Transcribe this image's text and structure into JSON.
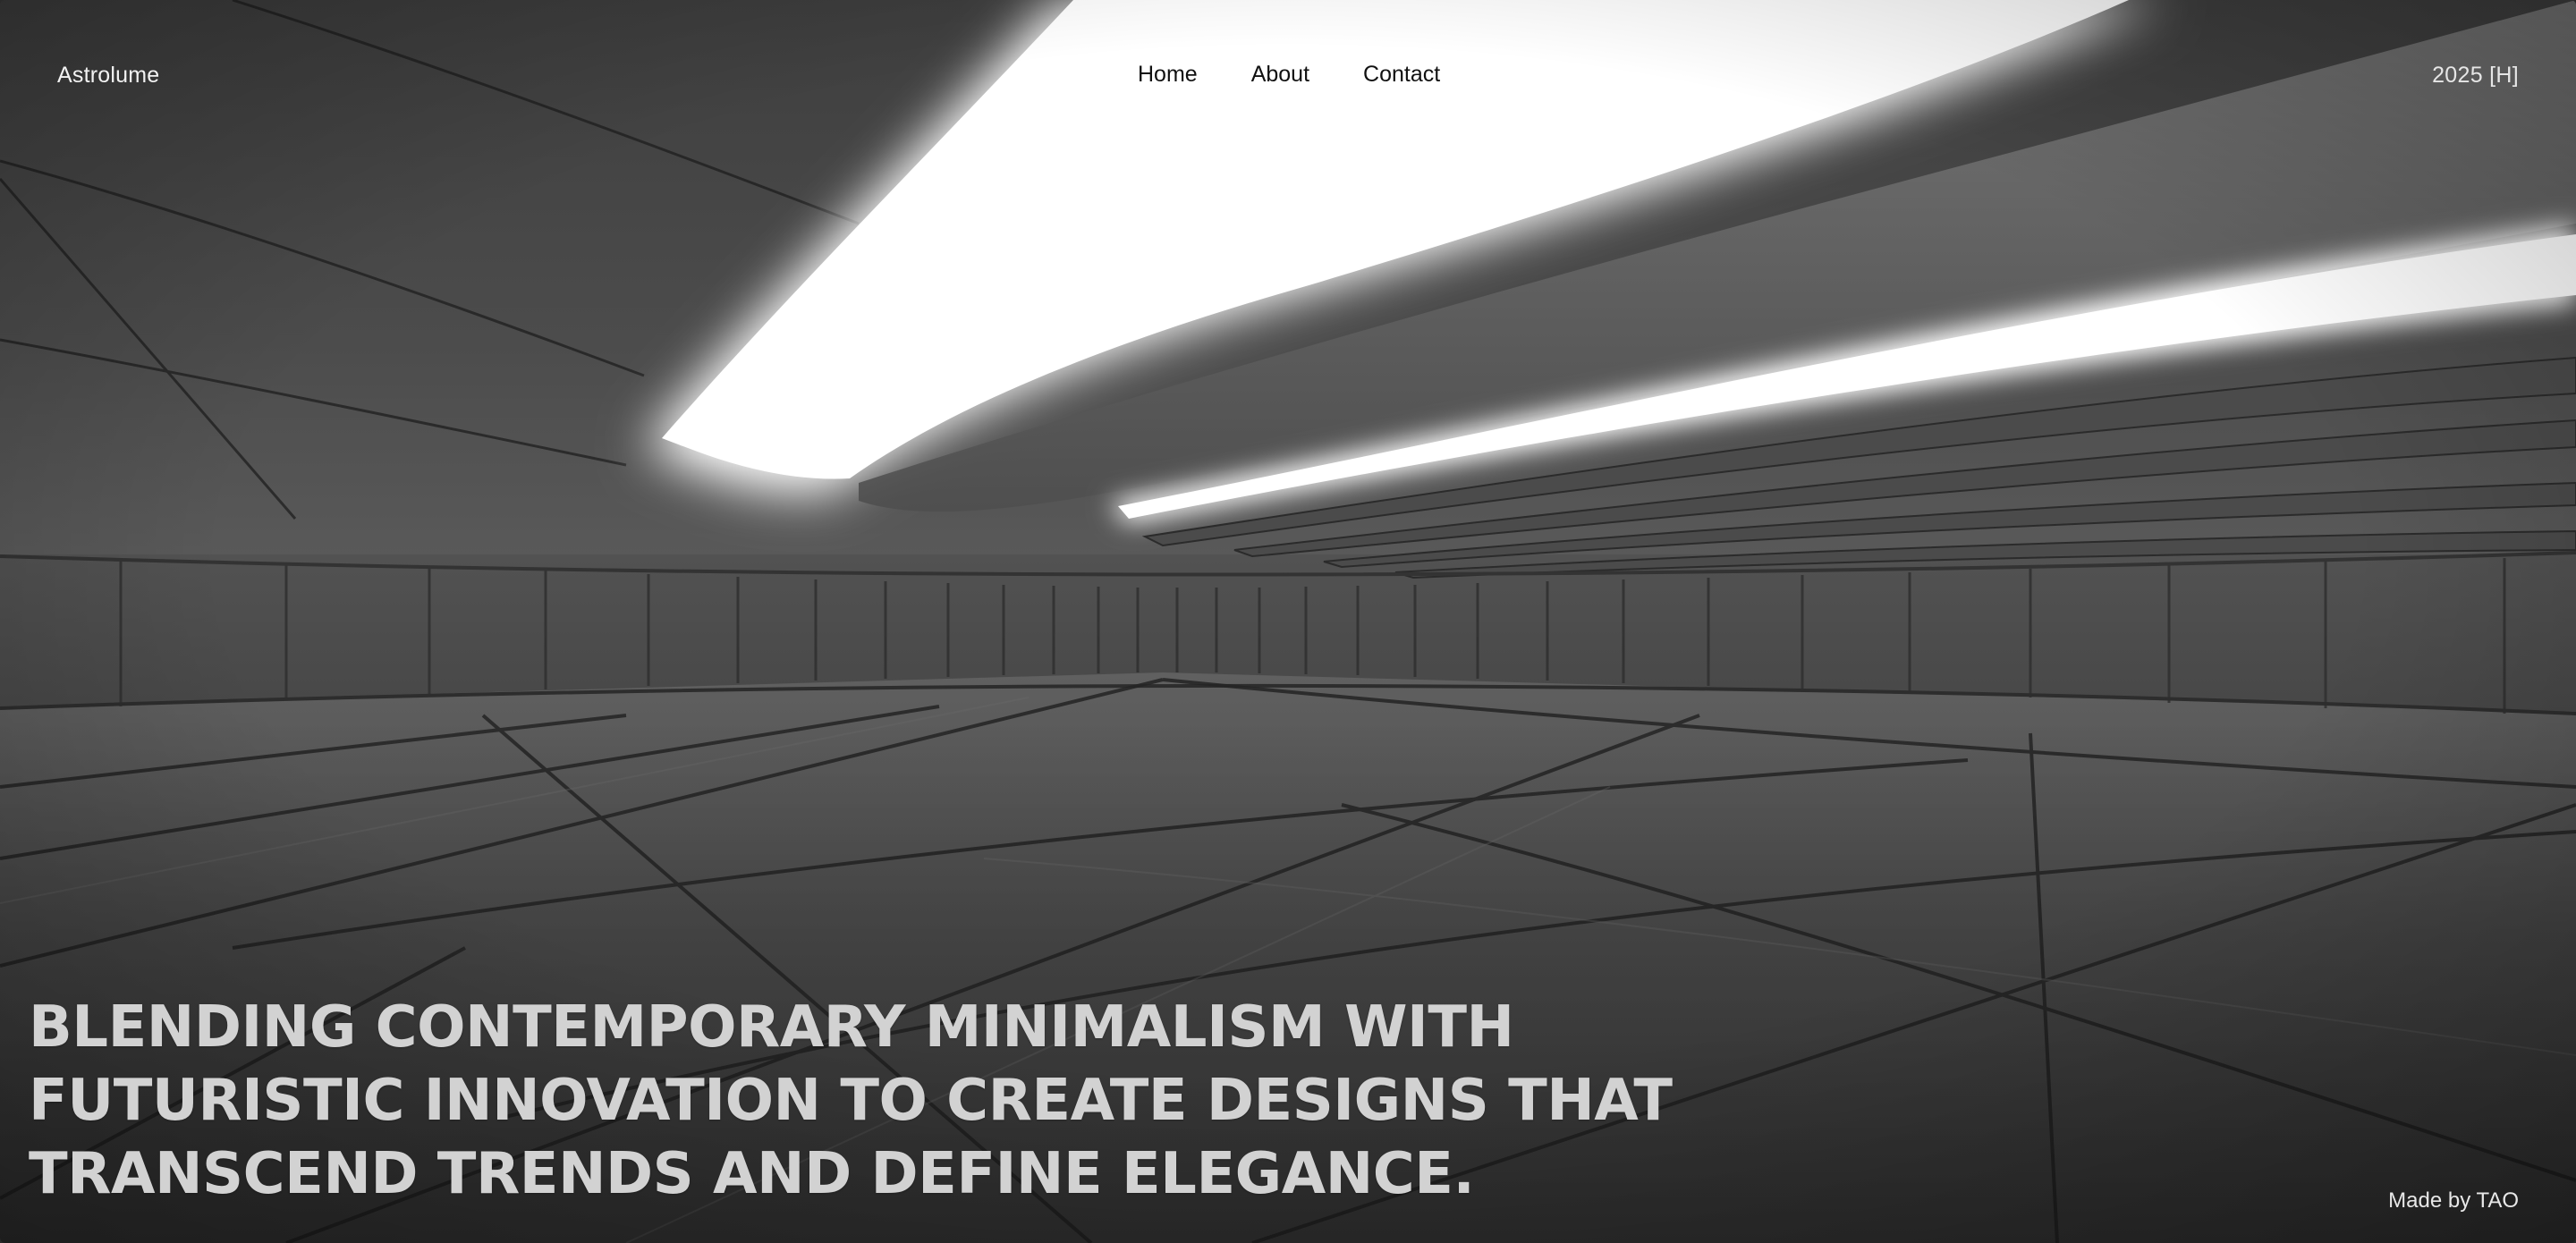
{
  "brand": {
    "name": "Astrolume"
  },
  "nav": {
    "items": [
      {
        "label": "Home"
      },
      {
        "label": "About"
      },
      {
        "label": "Contact"
      }
    ]
  },
  "meta": {
    "year_label": "2025 [H]"
  },
  "hero": {
    "headline_lines": [
      "BLENDING CONTEMPORARY MINIMALISM WITH",
      "FUTURISTIC INNOVATION TO CREATE DESIGNS THAT",
      "TRANSCEND TRENDS AND DEFINE ELEGANCE."
    ]
  },
  "footer": {
    "credit": "Made by TAO"
  },
  "colors": {
    "concrete_dark": "#3a3a3a",
    "concrete_mid": "#5a5a5a",
    "light_glow": "#ffffff",
    "headline_text": "#d2d2d2",
    "nav_text": "#111111"
  }
}
